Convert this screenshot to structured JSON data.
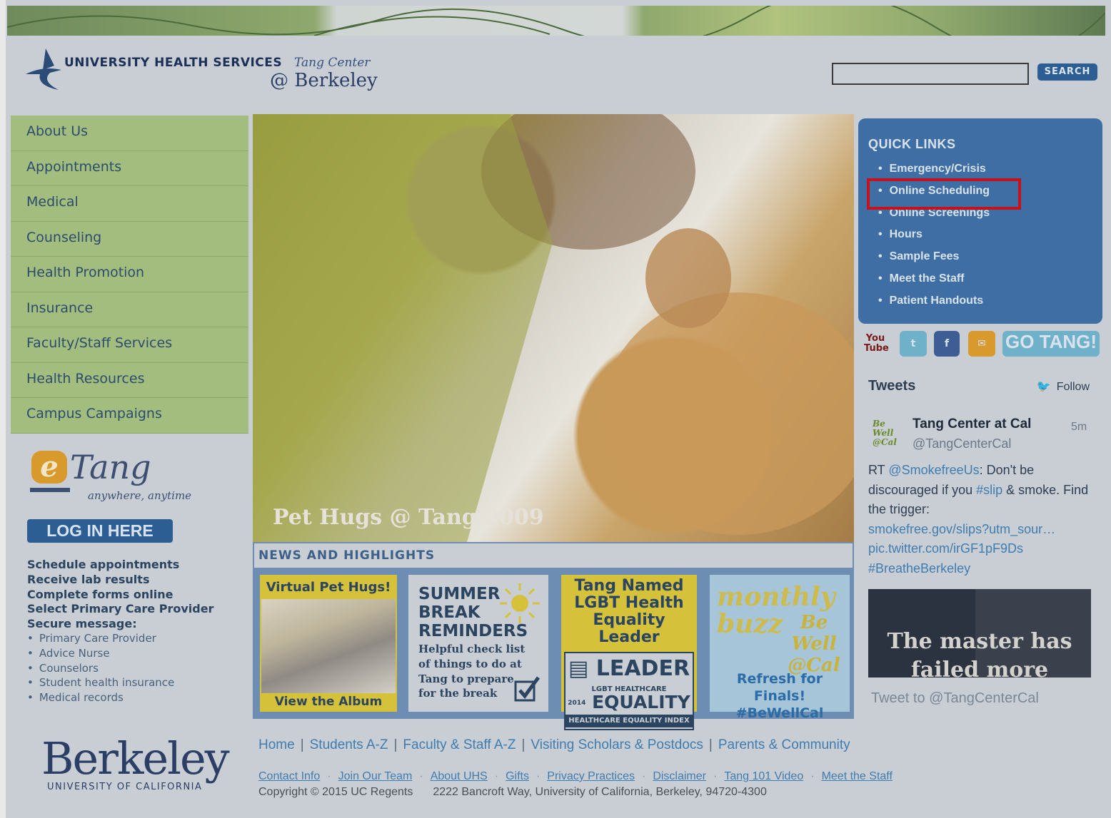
{
  "header": {
    "logo_line1": "UNIVERSITY HEALTH SERVICES",
    "logo_tang": "Tang Center",
    "logo_berkeley": "@ Berkeley",
    "search_placeholder": "",
    "search_button": "SEARCH"
  },
  "nav": {
    "items": [
      "About Us",
      "Appointments",
      "Medical",
      "Counseling",
      "Health Promotion",
      "Insurance",
      "Faculty/Staff Services",
      "Health Resources",
      "Campus Campaigns"
    ]
  },
  "etang": {
    "e": "e",
    "tang": "Tang",
    "tagline": "anywhere, anytime",
    "login_button": "LOG IN HERE",
    "features": [
      "Schedule appointments",
      "Receive lab results",
      "Complete forms online",
      "Select Primary Care Provider",
      "Secure message:"
    ],
    "secure_message_items": [
      "Primary Care Provider",
      "Advice Nurse",
      "Counselors",
      "Student health insurance",
      "Medical records"
    ]
  },
  "hero": {
    "caption": "Pet Hugs @ Tang 2009"
  },
  "news": {
    "heading": "NEWS AND HIGHLIGHTS",
    "tile1_title": "Virtual Pet Hugs!",
    "tile1_bottom": "View the Album",
    "tile2_title": [
      "SUMMER",
      "BREAK",
      "REMINDERS"
    ],
    "tile2_text": [
      "Helpful check list",
      "of things to do at",
      "Tang to prepare",
      "for the break"
    ],
    "tile3_title": [
      "Tang Named",
      "LGBT Health",
      "Equality Leader"
    ],
    "tile3_badge_top": "LEADER",
    "tile3_badge_mid": "LGBT HEALTHCARE",
    "tile3_badge_big": "EQUALITY",
    "tile3_badge_year": "2014",
    "tile3_badge_bottom": "HEALTHCARE EQUALITY INDEX",
    "tile4_title": "monthly buzz",
    "tile4_bewell": "Be Well @Cal",
    "tile4_text": [
      "Refresh for Finals!",
      "#BeWellCal"
    ]
  },
  "quick_links": {
    "heading": "QUICK LINKS",
    "items": [
      "Emergency/Crisis",
      "Online Scheduling",
      "Online Screenings",
      "Hours",
      "Sample Fees",
      "Meet the Staff",
      "Patient Handouts"
    ],
    "highlighted": "Online Scheduling"
  },
  "social": {
    "youtube": "You Tube",
    "twitter": "t",
    "facebook": "f",
    "go_tang": "GO TANG!"
  },
  "tweets": {
    "title": "Tweets",
    "follow": "Follow",
    "avatar_text": "Be Well @Cal",
    "name": "Tang Center at Cal",
    "handle": "@TangCenterCal",
    "time": "5m",
    "body_1": "RT ",
    "body_mention": "@SmokefreeUs",
    "body_2": ": Don't be discouraged if you ",
    "body_hashtag": "#slip",
    "body_3": " & smoke. Find the trigger:",
    "link1": "smokefree.gov/slips?utm_sour…",
    "link2": "pic.twitter.com/irGF1pF9Ds",
    "link3": "#BreatheBerkeley",
    "image_text": "The master has failed more",
    "tweet_to": "Tweet to @TangCenterCal"
  },
  "footer": {
    "berkeley": "Berkeley",
    "university": "UNIVERSITY OF CALIFORNIA",
    "nav": [
      "Home",
      "Students A-Z",
      "Faculty & Staff A-Z",
      "Visiting Scholars & Postdocs",
      "Parents & Community"
    ],
    "nav_separator": "|",
    "links": [
      "Contact Info",
      "Join Our Team",
      "About UHS",
      "Gifts",
      "Privacy Practices",
      "Disclaimer",
      "Tang 101 Video",
      "Meet the Staff"
    ],
    "links_separator": "·",
    "copyright": "Copyright © 2015 UC Regents",
    "address": "2222 Bancroft Way, University of California, Berkeley, 94720-4300"
  },
  "colors": {
    "nav_green": "#a2bd7d",
    "brand_blue": "#2c5e94",
    "quick_links_blue": "#3e6ea4",
    "highlight_red": "#c8121b"
  }
}
